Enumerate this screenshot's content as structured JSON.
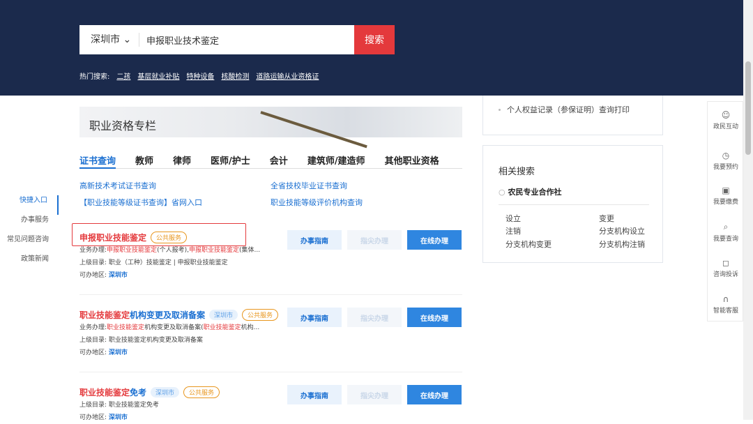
{
  "search": {
    "city": "深圳市",
    "value": "申报职业技术鉴定",
    "button": "搜索"
  },
  "hot": {
    "label": "热门搜索:",
    "items": [
      "二孩",
      "基层就业补贴",
      "特种设备",
      "核酸检测",
      "道路运输从业资格证"
    ]
  },
  "leftnav": [
    "快捷入口",
    "办事服务",
    "常见问题咨询",
    "政策新闻"
  ],
  "banner": {
    "title": "职业资格专栏"
  },
  "tabs": [
    "证书查询",
    "教师",
    "律师",
    "医师/护士",
    "会计",
    "建筑师/建造师",
    "其他职业资格"
  ],
  "links": [
    "高新技术考试证书查询",
    "全省技校毕业证书查询",
    "【职业技能等级证书查询】省网入口",
    "职业技能等级评价机构查询"
  ],
  "buttons": {
    "guide": "办事指南",
    "seek": "指尖办理",
    "online": "在线办理"
  },
  "items": [
    {
      "title_red": "申报职业技能鉴定",
      "title_blue": "",
      "city_tag": "",
      "tag": "公共服务",
      "biz_label": "业务办理:",
      "biz_1": "申报职业技能鉴定",
      "biz_2": "(个人报考),",
      "biz_3": "申报职业技能鉴定",
      "biz_4": "(集体...",
      "parent": "上级目录: 职业（工种）技能鉴定 | 申报职业技能鉴定",
      "area_label": "可办地区:",
      "area": "深圳市"
    },
    {
      "title_red": "职业技能鉴定",
      "title_blue": "机构变更及取消备案",
      "city_tag": "深圳市",
      "tag": "公共服务",
      "biz_label": "业务办理:",
      "biz_1": "职业技能鉴定",
      "biz_2": "机构变更及取消备案(",
      "biz_3": "职业技能鉴定",
      "biz_4": "机构...",
      "parent": "上级目录: 职业技能鉴定机构变更及取消备案",
      "area_label": "可办地区:",
      "area": "深圳市"
    },
    {
      "title_red": "职业技能鉴定",
      "title_blue": "免考",
      "city_tag": "深圳市",
      "tag": "公共服务",
      "parent": "上级目录: 职业技能鉴定免考",
      "area_label": "可办地区:",
      "area": "深圳市"
    }
  ],
  "side": {
    "record": "个人权益记录（参保证明）查询打印",
    "related_title": "相关搜索",
    "keyword": "农民专业合作社",
    "related": [
      "设立",
      "变更",
      "注销",
      "分支机构设立",
      "分支机构变更",
      "分支机构注销"
    ]
  },
  "rightbar": [
    "政民互动",
    "我要预约",
    "我要缴费",
    "我要查询",
    "咨询投诉",
    "智能客服"
  ]
}
